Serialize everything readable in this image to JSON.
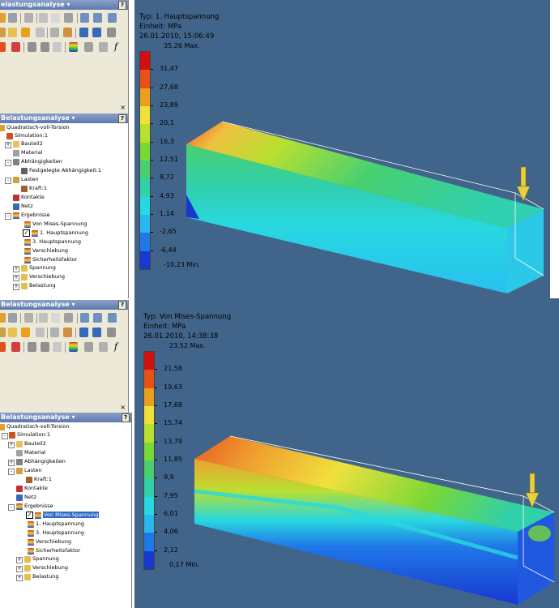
{
  "panel_top": {
    "title": "elastungsanalyse ▾",
    "help": "?",
    "close": "×",
    "fx": "f"
  },
  "tree_top": {
    "title": "Belastungsanalyse ▾",
    "help": "?",
    "root": "Quadratisch-voll-Torsion",
    "items": [
      "Simulation:1",
      "Bauteil2",
      "Material",
      "Abhängigkeiten",
      "Festgelegte Abhängigkeit:1",
      "Lasten",
      "Kraft:1",
      "Kontakte",
      "Netz",
      "Ergebnisse",
      "Von Mises-Spannung",
      "1. Hauptspannung",
      "3. Hauptspannung",
      "Verschiebung",
      "Sicherheitsfaktor",
      "Spannung",
      "Verschiebung",
      "Belastung"
    ]
  },
  "panel_bottom": {
    "title": "Belastungsanalyse ▾",
    "help": "?",
    "close": "×",
    "fx": "f"
  },
  "tree_bottom": {
    "title": "Belastungsanalyse ▾",
    "help": "?",
    "root": "Quadratisch-voll-Torsion",
    "items": [
      "Simulation:1",
      "Bauteil2",
      "Material",
      "Abhängigkeiten",
      "Lasten",
      "Kraft:1",
      "Kontakte",
      "Netz",
      "Ergebnisse",
      "Von Mises-Spannung",
      "1. Hauptspannung",
      "3. Hauptspannung",
      "Verschiebung",
      "Sicherheitsfaktor",
      "Spannung",
      "Verschiebung",
      "Belastung"
    ]
  },
  "viewport_top": {
    "type_line": "Typ: 1. Hauptspannung",
    "unit_line": "Einheit: MPa",
    "date_line": "26.01.2010, 15:06:49",
    "max_label": "35,26 Max.",
    "min_label": "-10,23 Min.",
    "ticks": [
      "31,47",
      "27,68",
      "23,89",
      "20,1",
      "16,3",
      "12,51",
      "8,72",
      "4,93",
      "1,14",
      "-2,65",
      "-6,44"
    ],
    "colors": [
      "#d01010",
      "#e8501a",
      "#e9a020",
      "#f0e03c",
      "#b8e030",
      "#78d838",
      "#48d070",
      "#30d0a8",
      "#28d8e0",
      "#28b8f0",
      "#2078e8",
      "#1838d0"
    ]
  },
  "viewport_bottom": {
    "type_line": "Typ: Von Mises-Spannung",
    "unit_line": "Einheit: MPa",
    "date_line": "26.01.2010, 14:38:38",
    "max_label": "23,52 Max.",
    "min_label": "0,17 Min.",
    "ticks": [
      "21,58",
      "19,63",
      "17,68",
      "15,74",
      "13,79",
      "11,85",
      "9,9",
      "7,95",
      "6,01",
      "4,06",
      "2,12"
    ],
    "colors": [
      "#d01010",
      "#e8501a",
      "#e9a020",
      "#f0e03c",
      "#b8e030",
      "#78d838",
      "#48d070",
      "#30d0a8",
      "#28d8e0",
      "#28b8f0",
      "#2078e8",
      "#1838d0"
    ]
  }
}
